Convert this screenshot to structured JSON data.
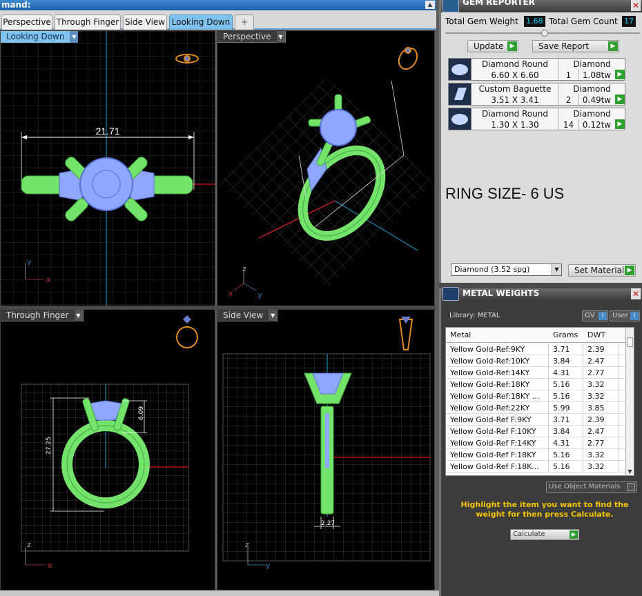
{
  "command_bar": {
    "text": "mand:"
  },
  "tabs": [
    {
      "label": "Perspective"
    },
    {
      "label": "Through Finger"
    },
    {
      "label": "Side View"
    },
    {
      "label": "Looking Down"
    },
    {
      "label": "+"
    }
  ],
  "viewports": {
    "top_left": {
      "label": "Looking Down",
      "dimension": "21.71",
      "axis_y": "y",
      "axis_x": "x"
    },
    "top_right": {
      "label": "Perspective",
      "axis_z": "z",
      "axis_x": "x",
      "axis_y": "y"
    },
    "bottom_left": {
      "label": "Through Finger",
      "dim_height": "27.25",
      "dim_head": "6.09",
      "axis_z": "z",
      "axis_x": "x"
    },
    "bottom_right": {
      "label": "Side View",
      "dim_width": "2.27",
      "axis_z": "z",
      "axis_y": "y"
    }
  },
  "gem_reporter": {
    "title": "GEM REPORTER",
    "total_weight_label": "Total Gem Weight",
    "total_weight_value": "1.68",
    "total_count_label": "Total Gem Count",
    "total_count_value": "17",
    "update_label": "Update",
    "save_label": "Save Report",
    "gems": [
      {
        "name": "Diamond Round",
        "size": "6.60 X 6.60",
        "material": "Diamond",
        "count": "1",
        "weight": "1.08tw"
      },
      {
        "name": "Custom Baguette",
        "size": "3.51 X 3.41",
        "material": "Diamond",
        "count": "2",
        "weight": "0.49tw"
      },
      {
        "name": "Diamond Round",
        "size": "1.30 X 1.30",
        "material": "Diamond",
        "count": "14",
        "weight": "0.12tw"
      }
    ],
    "ring_size": "RING SIZE- 6 US",
    "material_select": "Diamond    (3.52 spg)",
    "set_material_label": "Set Material"
  },
  "metal_weights": {
    "title": "METAL WEIGHTS",
    "library_label": "Library: METAL",
    "gv_label": "GV",
    "user_label": "User",
    "columns": [
      "Metal",
      "Grams",
      "DWT"
    ],
    "rows": [
      [
        "Yellow Gold-Ref:9KY",
        "3.71",
        "2.39"
      ],
      [
        "Yellow Gold-Ref:10KY",
        "3.84",
        "2.47"
      ],
      [
        "Yellow Gold-Ref:14KY",
        "4.31",
        "2.77"
      ],
      [
        "Yellow Gold-Ref:18KY",
        "5.16",
        "3.32"
      ],
      [
        "Yellow Gold-Ref:18KY ...",
        "5.16",
        "3.32"
      ],
      [
        "Yellow Gold-Ref:22KY",
        "5.99",
        "3.85"
      ],
      [
        "Yellow Gold-Ref F:9KY",
        "3.71",
        "2.39"
      ],
      [
        "Yellow Gold-Ref F:10KY",
        "3.84",
        "2.47"
      ],
      [
        "Yellow Gold-Ref F:14KY",
        "4.31",
        "2.77"
      ],
      [
        "Yellow Gold-Ref F:18KY",
        "5.16",
        "3.32"
      ],
      [
        "Yellow Gold-Ref F:18K...",
        "5.16",
        "3.32"
      ]
    ],
    "use_object_label": "Use Object Materials",
    "hint": "Highlight the item you want to find the weight for then press Calculate.",
    "calculate_label": "Calculate"
  },
  "colors": {
    "accent": "#7fc2ee",
    "ring": "#7cf06a",
    "gem": "#8fa8ff",
    "hint": "#f5c400"
  }
}
